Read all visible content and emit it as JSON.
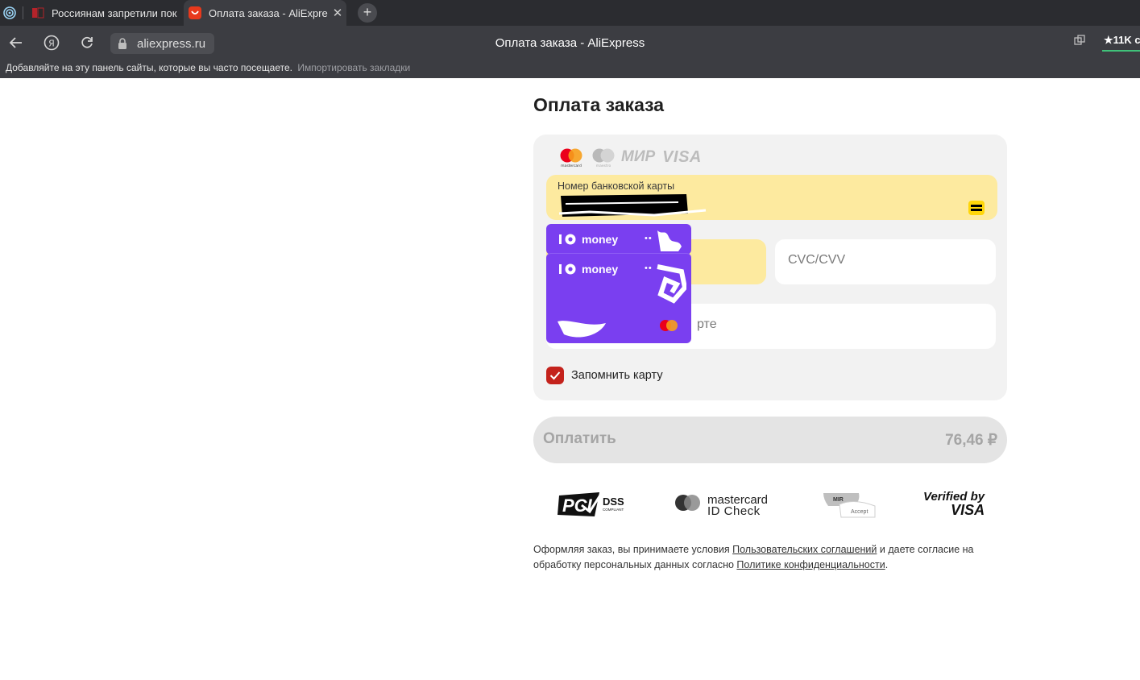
{
  "browser": {
    "tabs": [
      {
        "title": "Россиянам запретили пок",
        "active": false
      },
      {
        "title": "Оплата заказа - AliExpre",
        "active": true
      }
    ],
    "url": "aliexpress.ru",
    "page_caption": "Оплата заказа - AliExpress",
    "rating": "★11K с",
    "bookmarks_hint": "Добавляйте на эту панель сайты, которые вы часто посещаете.",
    "bookmarks_import": "Импортировать закладки"
  },
  "page": {
    "title": "Оплата заказа",
    "card_logos": [
      "mastercard-logo",
      "maestro-logo",
      "МИР",
      "VISA"
    ],
    "card_number_label": "Номер банковской карты",
    "cvc_placeholder": "CVC/CVV",
    "holder_placeholder": "рте",
    "saved_cards": [
      {
        "brand": "money",
        "dots": "••"
      },
      {
        "brand": "money",
        "dots": "••"
      }
    ],
    "remember_label": "Запомнить карту",
    "remember_checked": true,
    "pay_label": "Оплатить",
    "pay_amount": "76,46 ₽",
    "badges": {
      "pci": "PCI",
      "dss": "DSS",
      "dss_sub": "COMPLIANT",
      "mc_line1": "mastercard",
      "mc_line2": "ID Check",
      "mir": "MIR",
      "mir_sub": "Accept",
      "vbv_line1": "Verified by",
      "vbv_line2": "VISA"
    },
    "legal": {
      "part1": "Оформляя заказ, вы принимаете условия ",
      "link1": "Пользовательских соглашений",
      "part2": " и даете согласие на обработку персональных данных согласно ",
      "link2": "Политике конфиденциальности",
      "part3": "."
    }
  },
  "colors": {
    "accent_red": "#c4221c",
    "field_yellow": "#fdea9f",
    "card_purple": "#7a3ff0"
  }
}
